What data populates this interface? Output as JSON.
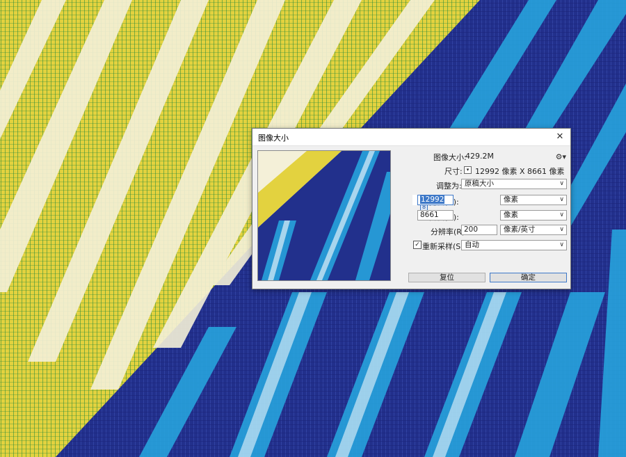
{
  "dialog": {
    "title": "图像大小",
    "close_icon": "close-icon",
    "image_size_label": "图像大小:",
    "image_size_value": "429.2M",
    "settings_icon": "gear-icon",
    "dimensions_label": "尺寸:",
    "dimensions_value": "12992 像素  X  8661 像素",
    "fit_to_label": "调整为:",
    "fit_to_value": "原稿大小",
    "width_label": "宽度(D):",
    "width_value": "12992",
    "width_unit": "像素",
    "height_label": "高度(G):",
    "height_value": "8661",
    "height_unit": "像素",
    "resolution_label": "分辨率(R):",
    "resolution_value": "200",
    "resolution_unit": "像素/英寸",
    "resample_label": "重新采样(S):",
    "resample_checked": true,
    "resample_value": "自动",
    "reset_button": "复位",
    "ok_button": "确定"
  },
  "colors": {
    "yellow": "#e3d23f",
    "green": "#1f8a3c",
    "navy": "#22308c",
    "cyan": "#1aa8e0",
    "accent": "#3d78c8"
  }
}
